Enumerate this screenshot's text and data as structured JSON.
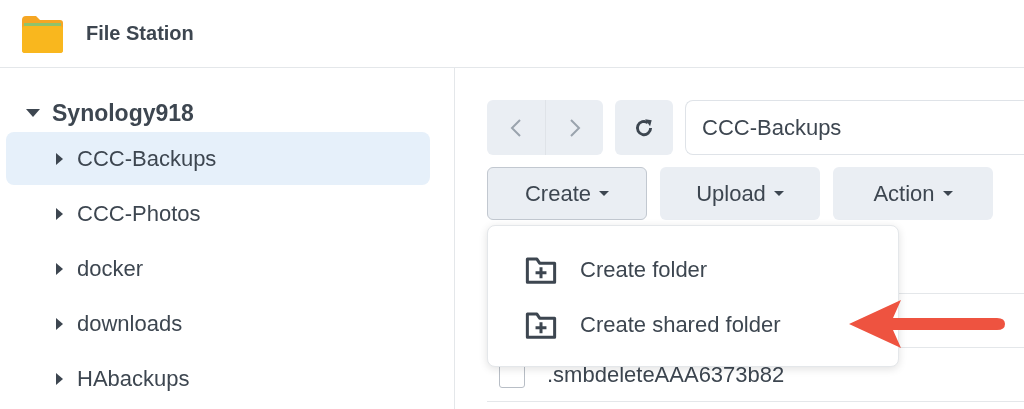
{
  "window": {
    "title": "File Station"
  },
  "tree": {
    "label": "Synology918",
    "expanded": true,
    "children": [
      {
        "label": "CCC-Backups",
        "expanded": false,
        "selected": true
      },
      {
        "label": "CCC-Photos",
        "expanded": false,
        "selected": false
      },
      {
        "label": "docker",
        "expanded": false,
        "selected": false
      },
      {
        "label": "downloads",
        "expanded": false,
        "selected": false
      },
      {
        "label": "HAbackups",
        "expanded": false,
        "selected": false
      }
    ]
  },
  "path": {
    "value": "CCC-Backups"
  },
  "toolbar": [
    {
      "label": "Create",
      "open": true
    },
    {
      "label": "Upload",
      "open": false
    },
    {
      "label": "Action",
      "open": false
    }
  ],
  "menu": {
    "items": [
      {
        "label": "Create folder",
        "highlighted": false
      },
      {
        "label": "Create shared folder",
        "highlighted": true
      }
    ]
  },
  "files": [
    {
      "name": ".smbdeleteAAA6373b82",
      "checked": false
    }
  ]
}
